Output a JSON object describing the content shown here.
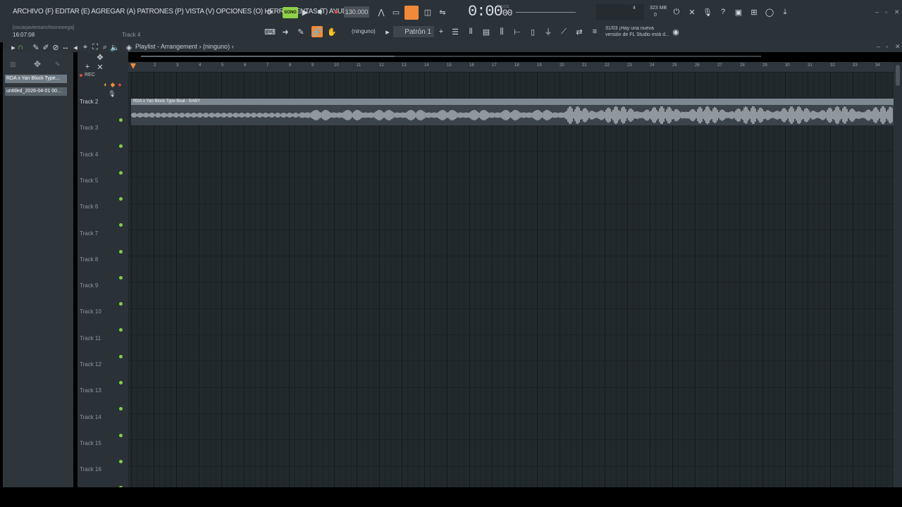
{
  "menu": {
    "text": "ARCHIVO (F) EDITAR (E) AGREGAR (A) PATRONES (P) VISTA (V) OPCIONES (O) HERRAMIENTAS (T) AYUDA"
  },
  "status": {
    "user": "[oscarjaviersancheznonega]",
    "clock": "16:07:08",
    "hint_track": "Track 4"
  },
  "transport": {
    "song_label": "SONG",
    "tempo": "130.000",
    "time_main": "0:00",
    "time_small": "00",
    "time_unit": "M:S:CS"
  },
  "memory": {
    "counter": "4",
    "mb": "323 MB",
    "zero": "0"
  },
  "news": {
    "date": "31/03",
    "line1": "¡Hay una nueva",
    "line2": "versión de FL Studio está d..."
  },
  "toolbar2": {
    "ninguno": "(ninguno)",
    "pattern": "Patrón 1"
  },
  "playlist": {
    "title": "Playlist - Arrangement › (ninguno) ›",
    "rec_label": "REC"
  },
  "browser": {
    "items": [
      "RDA x Yan Block Type...",
      "untitled_2026-04-01 00..."
    ]
  },
  "ruler": {
    "bars": [
      "1",
      "2",
      "3",
      "4",
      "5",
      "6",
      "7",
      "8",
      "9",
      "10",
      "11",
      "12",
      "13",
      "14",
      "15",
      "16",
      "17",
      "18",
      "19",
      "20",
      "21",
      "22",
      "23",
      "24",
      "25",
      "26",
      "27",
      "28",
      "29",
      "30",
      "31",
      "32",
      "33",
      "34"
    ]
  },
  "tracks": [
    "Track 2",
    "Track 3",
    "Track 4",
    "Track 5",
    "Track 6",
    "Track 7",
    "Track 8",
    "Track 9",
    "Track 10",
    "Track 11",
    "Track 12",
    "Track 13",
    "Track 14",
    "Track 15",
    "Track 16"
  ],
  "clip": {
    "title": "RDA x Yan Block Type Beat - BABY"
  },
  "colors": {
    "accent_orange": "#f08a3a",
    "song_green": "#8fd148",
    "track_dot": "#7ed04a"
  }
}
